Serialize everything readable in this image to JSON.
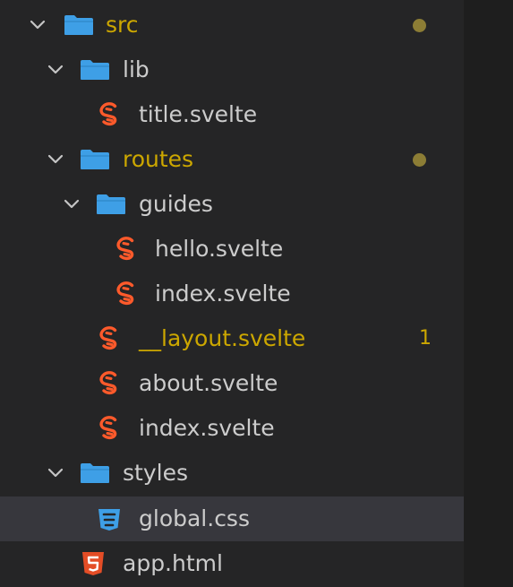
{
  "colors": {
    "sidebar_bg": "#252526",
    "selected_bg": "#37373d",
    "text": "#cccccc",
    "modified": "#cca700",
    "folder_icon": "#3e9fe6",
    "svelte_icon": "#ff5a2b",
    "css_icon": "#3e9fe6",
    "html_icon": "#e44d26"
  },
  "tree": {
    "src": {
      "label": "src",
      "icon": "folder-icon",
      "expanded": true,
      "modified": true
    },
    "lib": {
      "label": "lib",
      "icon": "folder-icon",
      "expanded": true
    },
    "lib_title": {
      "label": "title.svelte",
      "icon": "svelte-icon"
    },
    "routes": {
      "label": "routes",
      "icon": "folder-icon",
      "expanded": true,
      "modified": true
    },
    "guides": {
      "label": "guides",
      "icon": "folder-icon",
      "expanded": true
    },
    "guides_hello": {
      "label": "hello.svelte",
      "icon": "svelte-icon"
    },
    "guides_index": {
      "label": "index.svelte",
      "icon": "svelte-icon"
    },
    "routes_layout": {
      "label": "__layout.svelte",
      "icon": "svelte-icon",
      "problems": "1"
    },
    "routes_about": {
      "label": "about.svelte",
      "icon": "svelte-icon"
    },
    "routes_index": {
      "label": "index.svelte",
      "icon": "svelte-icon"
    },
    "styles": {
      "label": "styles",
      "icon": "folder-icon",
      "expanded": true
    },
    "styles_global": {
      "label": "global.css",
      "icon": "css-icon",
      "selected": true
    },
    "app_html": {
      "label": "app.html",
      "icon": "html5-icon"
    }
  }
}
